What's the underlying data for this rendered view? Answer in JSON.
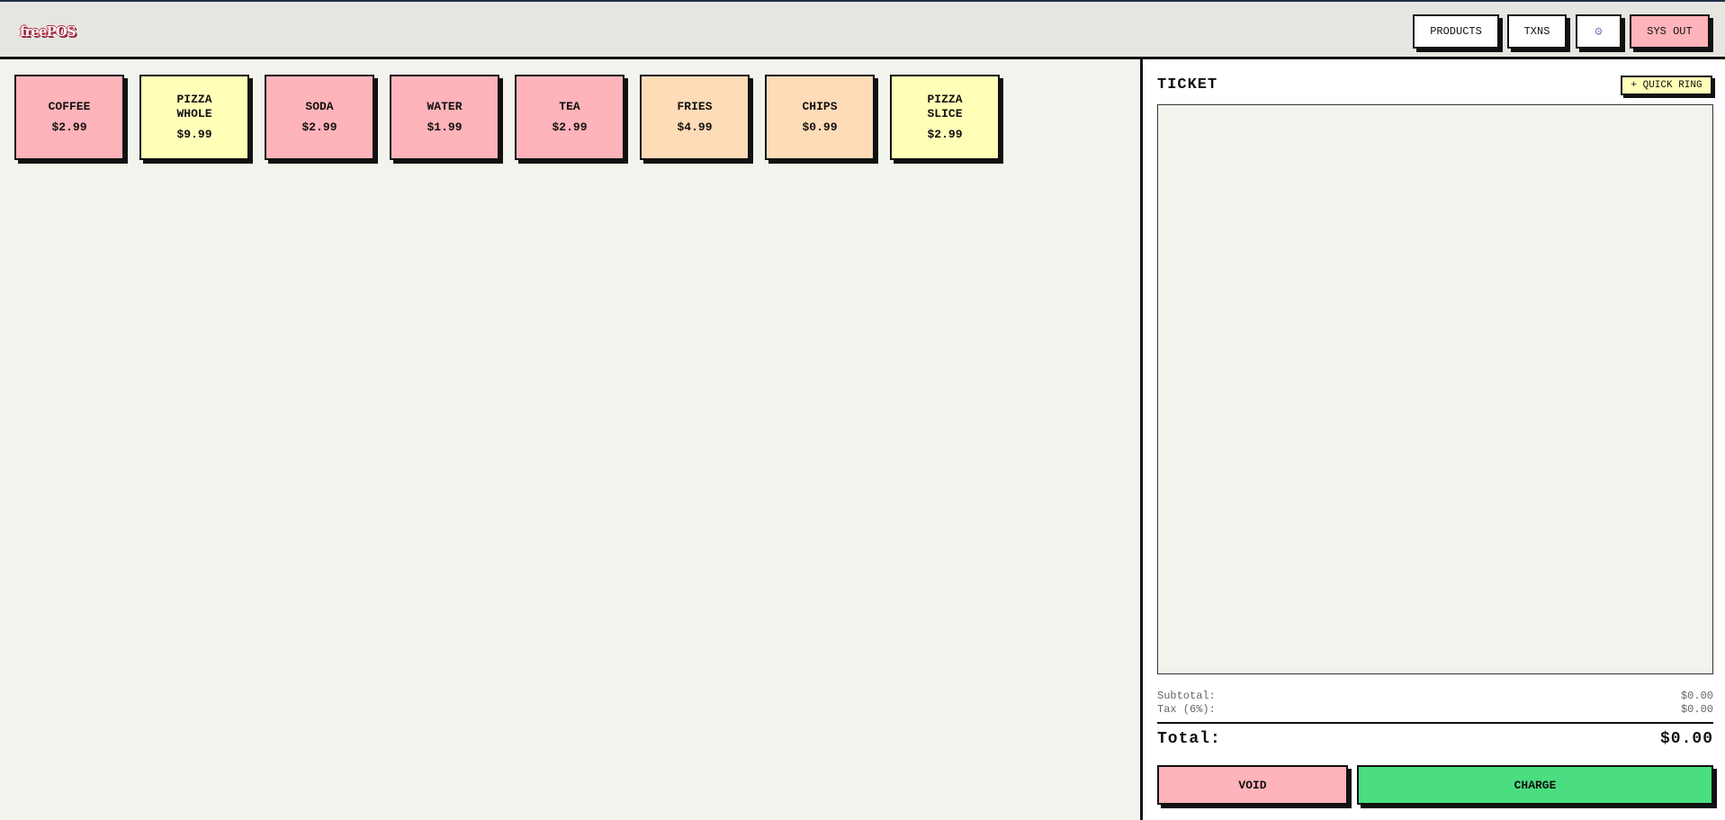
{
  "header": {
    "logo_text": "freePOS",
    "nav": [
      {
        "label": "PRODUCTS"
      },
      {
        "label": "TXNS"
      },
      {
        "label": "⚙",
        "icon": "gear-icon"
      },
      {
        "label": "SYS OUT"
      }
    ]
  },
  "products": [
    {
      "name": "COFFEE",
      "price": "$2.99",
      "color": "#ffb3ba"
    },
    {
      "name": "PIZZA WHOLE",
      "price": "$9.99",
      "color": "#ffffb8"
    },
    {
      "name": "SODA",
      "price": "$2.99",
      "color": "#ffb3ba"
    },
    {
      "name": "WATER",
      "price": "$1.99",
      "color": "#ffb3ba"
    },
    {
      "name": "TEA",
      "price": "$2.99",
      "color": "#ffb3ba"
    },
    {
      "name": "FRIES",
      "price": "$4.99",
      "color": "#ffdcb8"
    },
    {
      "name": "CHIPS",
      "price": "$0.99",
      "color": "#ffdcb8"
    },
    {
      "name": "PIZZA SLICE",
      "price": "$2.99",
      "color": "#ffffb8"
    }
  ],
  "ticket": {
    "title": "TICKET",
    "quick_ring_label": "+ QUICK RING",
    "items": [],
    "subtotal_label": "Subtotal:",
    "subtotal_value": "$0.00",
    "tax_label": "Tax (6%):",
    "tax_value": "$0.00",
    "total_label": "Total:",
    "total_value": "$0.00",
    "void_label": "VOID",
    "charge_label": "CHARGE"
  },
  "colors": {
    "pink": "#ffb3ba",
    "yellow": "#ffffb8",
    "peach": "#ffdcb8",
    "charge_green": "#4ade80"
  }
}
